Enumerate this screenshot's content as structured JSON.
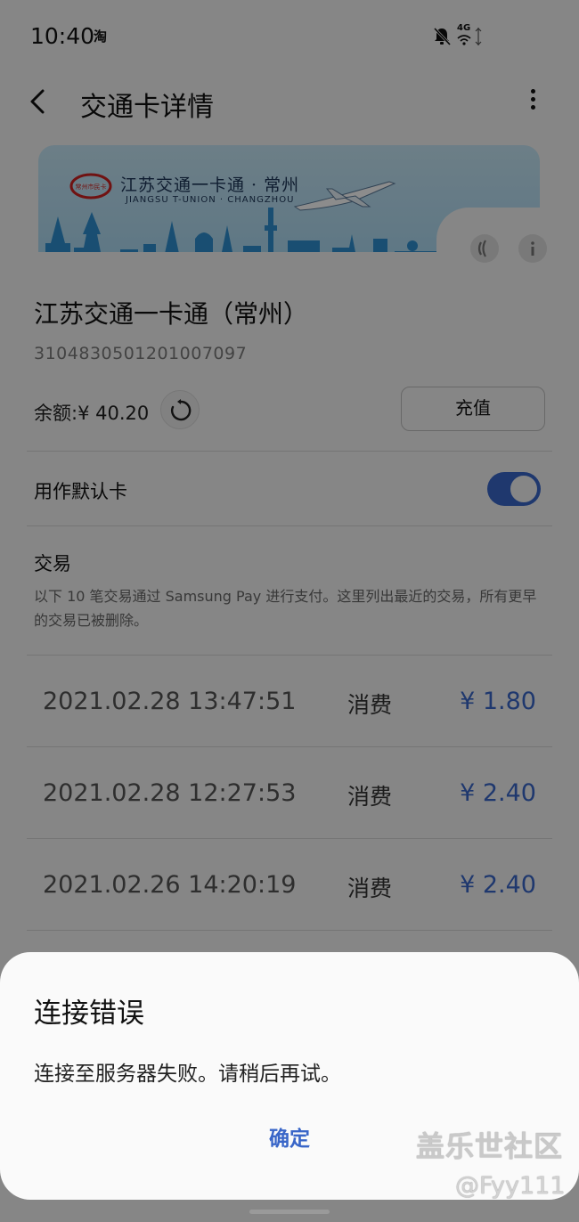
{
  "status_bar": {
    "time": "10:40",
    "app_icon_text": "淘",
    "network": "4G"
  },
  "header": {
    "title": "交通卡详情"
  },
  "card": {
    "title_cn": "江苏交通一卡通 · 常州",
    "title_en": "JIANGSU  T-UNION · CHANGZHOU",
    "nfc_icon": "nfc-icon",
    "info_icon": "info-icon"
  },
  "details": {
    "name": "江苏交通一卡通（常州）",
    "number": "3104830501201007097",
    "balance": "余额:¥ 40.20",
    "recharge_label": "充值",
    "default_label": "用作默认卡",
    "default_on": true
  },
  "transactions": {
    "heading": "交易",
    "note": "以下 10 笔交易通过 Samsung Pay 进行支付。这里列出最近的交易，所有更早的交易已被删除。",
    "rows": [
      {
        "date": "2021.02.28 13:47:51",
        "type": "消费",
        "amount": "¥ 1.80"
      },
      {
        "date": "2021.02.28 12:27:53",
        "type": "消费",
        "amount": "¥ 2.40"
      },
      {
        "date": "2021.02.26 14:20:19",
        "type": "消费",
        "amount": "¥ 2.40"
      }
    ]
  },
  "dialog": {
    "title": "连接错误",
    "message": "连接至服务器失败。请稍后再试。",
    "confirm": "确定"
  },
  "watermark": {
    "logo": "盖乐世社区",
    "user": "@Fyy111"
  },
  "colors": {
    "accent": "#3966c8",
    "card_bg": "#a9d8f1",
    "skyline": "#2f8fd0"
  }
}
